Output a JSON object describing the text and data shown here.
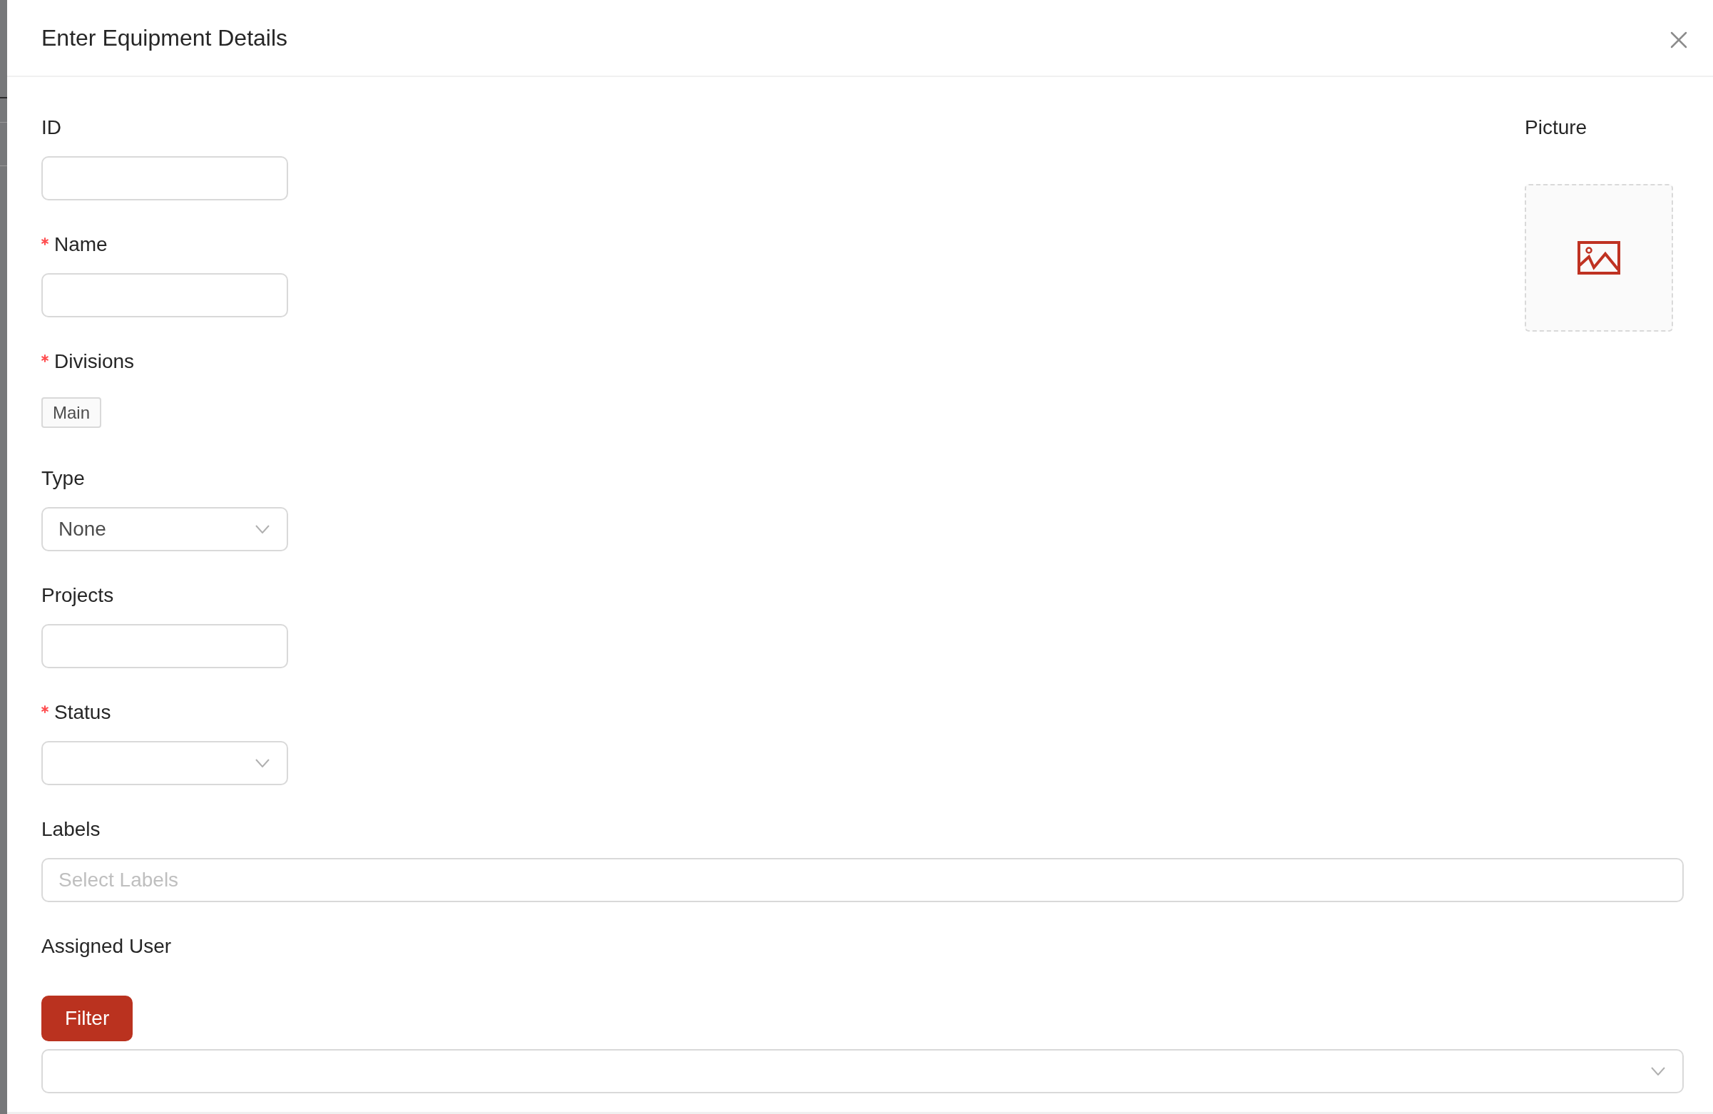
{
  "drawer": {
    "title": "Enter Equipment Details"
  },
  "fields": [
    {
      "kind": "text",
      "label": "ID",
      "required": false
    },
    {
      "kind": "text",
      "label": "Name",
      "required": true
    },
    {
      "kind": "tags",
      "label": "Divisions",
      "required": true,
      "tags": [
        "Main"
      ]
    },
    {
      "kind": "select",
      "label": "Type",
      "required": false,
      "value": "None"
    },
    {
      "kind": "text",
      "label": "Projects",
      "required": false
    },
    {
      "kind": "select",
      "label": "Status",
      "required": true
    }
  ],
  "picture": {
    "label": "Picture"
  },
  "wide_fields": [
    {
      "kind": "multiselect",
      "label": "Labels",
      "required": false,
      "placeholder": "Select Labels"
    },
    {
      "kind": "user-select",
      "label": "Assigned User",
      "required": false,
      "button": "Filter"
    }
  ]
}
